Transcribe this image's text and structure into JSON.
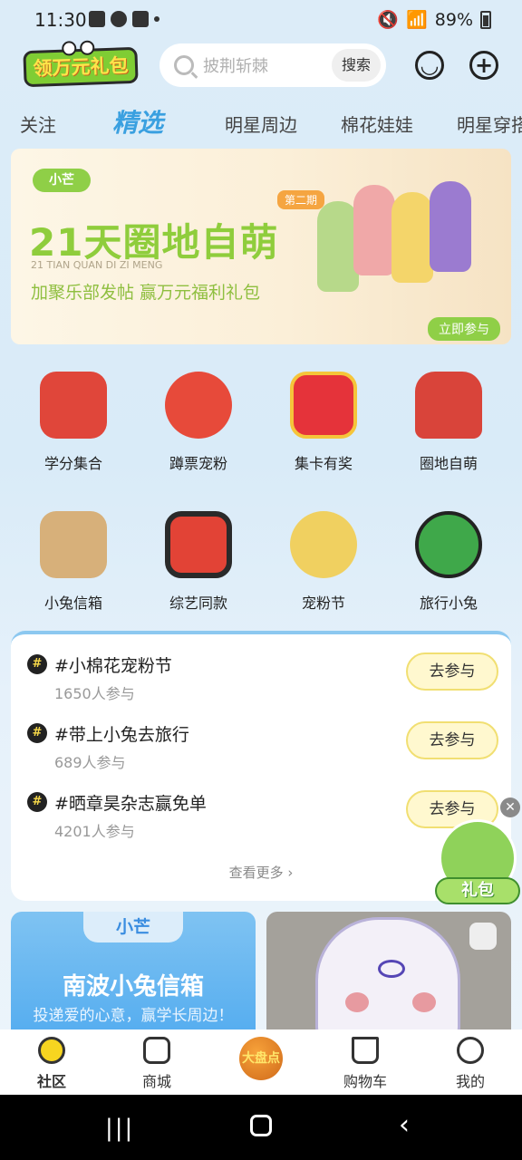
{
  "status_bar": {
    "time": "11:30",
    "battery": "89%"
  },
  "header": {
    "logo_text": "领万元礼包",
    "search_placeholder": "披荆斩棘",
    "search_button": "搜索",
    "icons": [
      "chat-icon",
      "add-icon"
    ]
  },
  "tabs": [
    {
      "label": "关注"
    },
    {
      "label": "精选",
      "active": true
    },
    {
      "label": "明星周边"
    },
    {
      "label": "棉花娃娃"
    },
    {
      "label": "明星穿搭"
    }
  ],
  "banner": {
    "brand": "小芒",
    "title": "21天圈地自萌",
    "subtitle": "21 TIAN QUAN DI ZI MENG",
    "desc": "加聚乐部发帖  赢万元福利礼包",
    "issue": "第二期",
    "cta": "立即参与"
  },
  "grid": [
    {
      "label": "学分集合",
      "icon": "slot-machine-icon",
      "color": "#e0463a"
    },
    {
      "label": "蹲票宠粉",
      "icon": "red-cat-icon",
      "color": "#e74a3a"
    },
    {
      "label": "集卡有奖",
      "icon": "gift-box-icon",
      "color": "#e5333a"
    },
    {
      "label": "圈地自萌",
      "icon": "red-car-icon",
      "color": "#d9443a"
    },
    {
      "label": "小兔信箱",
      "icon": "box-icon",
      "color": "#d7b07a"
    },
    {
      "label": "综艺同款",
      "icon": "tv-icon",
      "color": "#e24336"
    },
    {
      "label": "宠粉节",
      "icon": "doll-icon",
      "color": "#f0d060"
    },
    {
      "label": "旅行小兔",
      "icon": "bunny-travel-icon",
      "color": "#3fa84a"
    }
  ],
  "topics": [
    {
      "title": "#小棉花宠粉节",
      "count": "1650人参与",
      "button": "去参与"
    },
    {
      "title": "#带上小兔去旅行",
      "count": "689人参与",
      "button": "去参与"
    },
    {
      "title": "#晒章昊杂志赢免单",
      "count": "4201人参与",
      "button": "去参与"
    }
  ],
  "topics_more": "查看更多",
  "float_gift": {
    "label": "礼包"
  },
  "card_left": {
    "brand": "小芒",
    "title": "南波小兔信箱",
    "subtitle": "投递爱的心意，赢学长周边！"
  },
  "bottom_nav": [
    {
      "label": "社区",
      "active": true
    },
    {
      "label": "商城"
    },
    {
      "label": "大盘点",
      "center": true
    },
    {
      "label": "购物车"
    },
    {
      "label": "我的"
    }
  ]
}
